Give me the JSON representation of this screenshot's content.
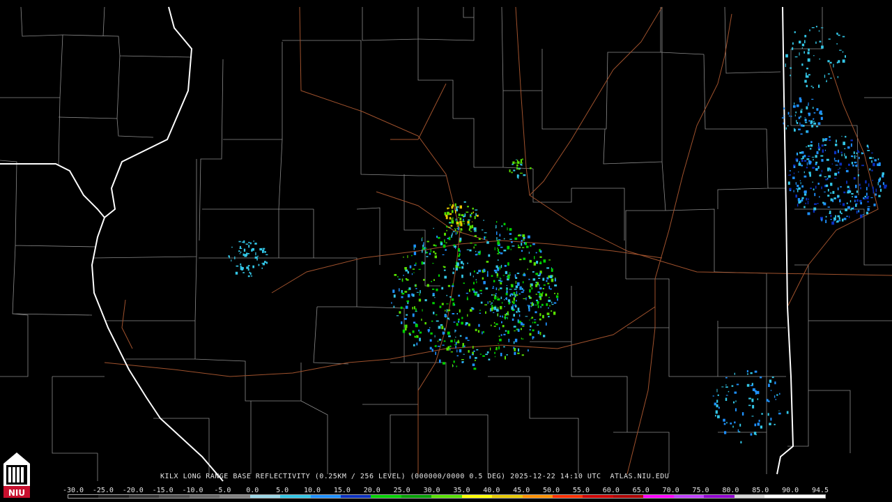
{
  "title": "KILX LONG RANGE BASE REFLECTIVITY (0.25KM / 256 LEVEL) (000000/0000 0.5 DEG) 2025-12-22 14:10 UTC  ATLAS.NIU.EDU",
  "logo_text": "NIU",
  "scale": {
    "labels": [
      "-30.0",
      "-25.0",
      "-20.0",
      "-15.0",
      "-10.0",
      "-5.0",
      "0.0",
      "5.0",
      "10.0",
      "15.0",
      "20.0",
      "25.0",
      "30.0",
      "35.0",
      "40.0",
      "45.0",
      "50.0",
      "55.0",
      "60.0",
      "65.0",
      "70.0",
      "75.0",
      "80.0",
      "85.0",
      "90.0",
      "94.5"
    ],
    "colors": [
      "#000000",
      "#1a1a1a",
      "#333333",
      "#4d4d4d",
      "#666666",
      "#808080",
      "#9ad6e6",
      "#33c6e6",
      "#1e90ff",
      "#0a30c0",
      "#00d000",
      "#00a000",
      "#58e000",
      "#ffff00",
      "#e6c800",
      "#ff9000",
      "#ff3000",
      "#d00000",
      "#b00000",
      "#ff00ff",
      "#c040ff",
      "#9000d0",
      "#d8d8d8",
      "#ffffff",
      "#ffffff"
    ]
  }
}
